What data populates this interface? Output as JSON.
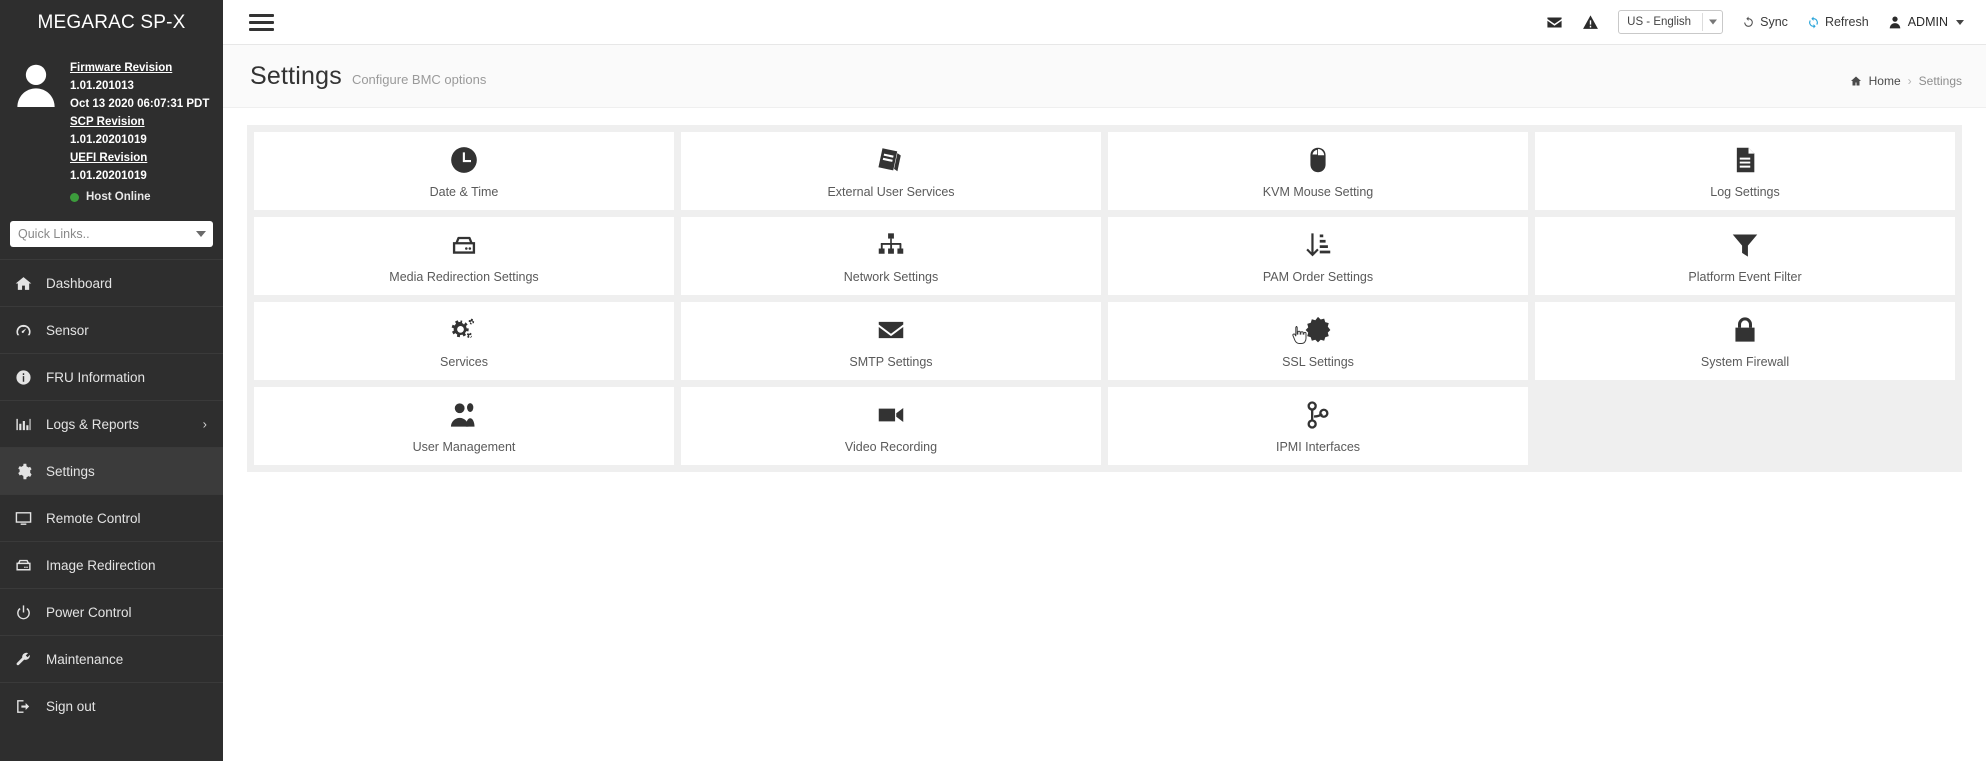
{
  "brand": {
    "title": "MEGARAC SP-X"
  },
  "sidebar": {
    "firmware": {
      "firmware_label": "Firmware Revision",
      "firmware_version": "1.01.201013",
      "firmware_date": "Oct 13 2020 06:07:31 PDT",
      "scp_label": "SCP Revision",
      "scp_version": "1.01.20201019",
      "uefi_label": "UEFI Revision",
      "uefi_version": "1.01.20201019",
      "host_status": "Host Online",
      "host_status_color": "#3c9c3c"
    },
    "quick_links": {
      "placeholder": "Quick Links..",
      "value": "Quick Links.."
    },
    "items": [
      {
        "label": "Dashboard",
        "icon": "home-icon",
        "active": false,
        "has_submenu": false
      },
      {
        "label": "Sensor",
        "icon": "gauge-icon",
        "active": false,
        "has_submenu": false
      },
      {
        "label": "FRU Information",
        "icon": "info-icon",
        "active": false,
        "has_submenu": false
      },
      {
        "label": "Logs & Reports",
        "icon": "bar-chart-icon",
        "active": false,
        "has_submenu": true
      },
      {
        "label": "Settings",
        "icon": "gear-icon",
        "active": true,
        "has_submenu": false
      },
      {
        "label": "Remote Control",
        "icon": "monitor-icon",
        "active": false,
        "has_submenu": false
      },
      {
        "label": "Image Redirection",
        "icon": "disk-icon",
        "active": false,
        "has_submenu": false
      },
      {
        "label": "Power Control",
        "icon": "power-icon",
        "active": false,
        "has_submenu": false
      },
      {
        "label": "Maintenance",
        "icon": "wrench-icon",
        "active": false,
        "has_submenu": false
      },
      {
        "label": "Sign out",
        "icon": "sign-out-icon",
        "active": false,
        "has_submenu": false
      }
    ],
    "submenu_chevron": "›"
  },
  "topbar": {
    "mail_icon": "envelope-icon",
    "alert_icon": "warning-icon",
    "language": {
      "value": "US - English"
    },
    "sync_label": "Sync",
    "refresh_label": "Refresh",
    "refresh_color": "#29a4d9",
    "user_label": "ADMIN"
  },
  "page": {
    "title": "Settings",
    "subtitle": "Configure BMC options",
    "breadcrumb": {
      "home": "Home",
      "divider": "›",
      "current": "Settings"
    }
  },
  "tiles": [
    {
      "label": "Date & Time",
      "icon": "clock-icon"
    },
    {
      "label": "External User Services",
      "icon": "book-icon"
    },
    {
      "label": "KVM Mouse Setting",
      "icon": "mouse-icon"
    },
    {
      "label": "Log Settings",
      "icon": "document-icon"
    },
    {
      "label": "Media Redirection Settings",
      "icon": "drive-icon"
    },
    {
      "label": "Network Settings",
      "icon": "sitemap-icon"
    },
    {
      "label": "PAM Order Settings",
      "icon": "sort-order-icon"
    },
    {
      "label": "Platform Event Filter",
      "icon": "funnel-icon"
    },
    {
      "label": "Services",
      "icon": "gears-icon"
    },
    {
      "label": "SMTP Settings",
      "icon": "envelope-icon"
    },
    {
      "label": "SSL Settings",
      "icon": "certificate-icon"
    },
    {
      "label": "System Firewall",
      "icon": "lock-icon"
    },
    {
      "label": "User Management",
      "icon": "users-icon"
    },
    {
      "label": "Video Recording",
      "icon": "video-camera-icon"
    },
    {
      "label": "IPMI Interfaces",
      "icon": "code-fork-icon"
    }
  ],
  "cursor": {
    "type": "pointer-hand",
    "over_tile": "SSL Settings"
  }
}
